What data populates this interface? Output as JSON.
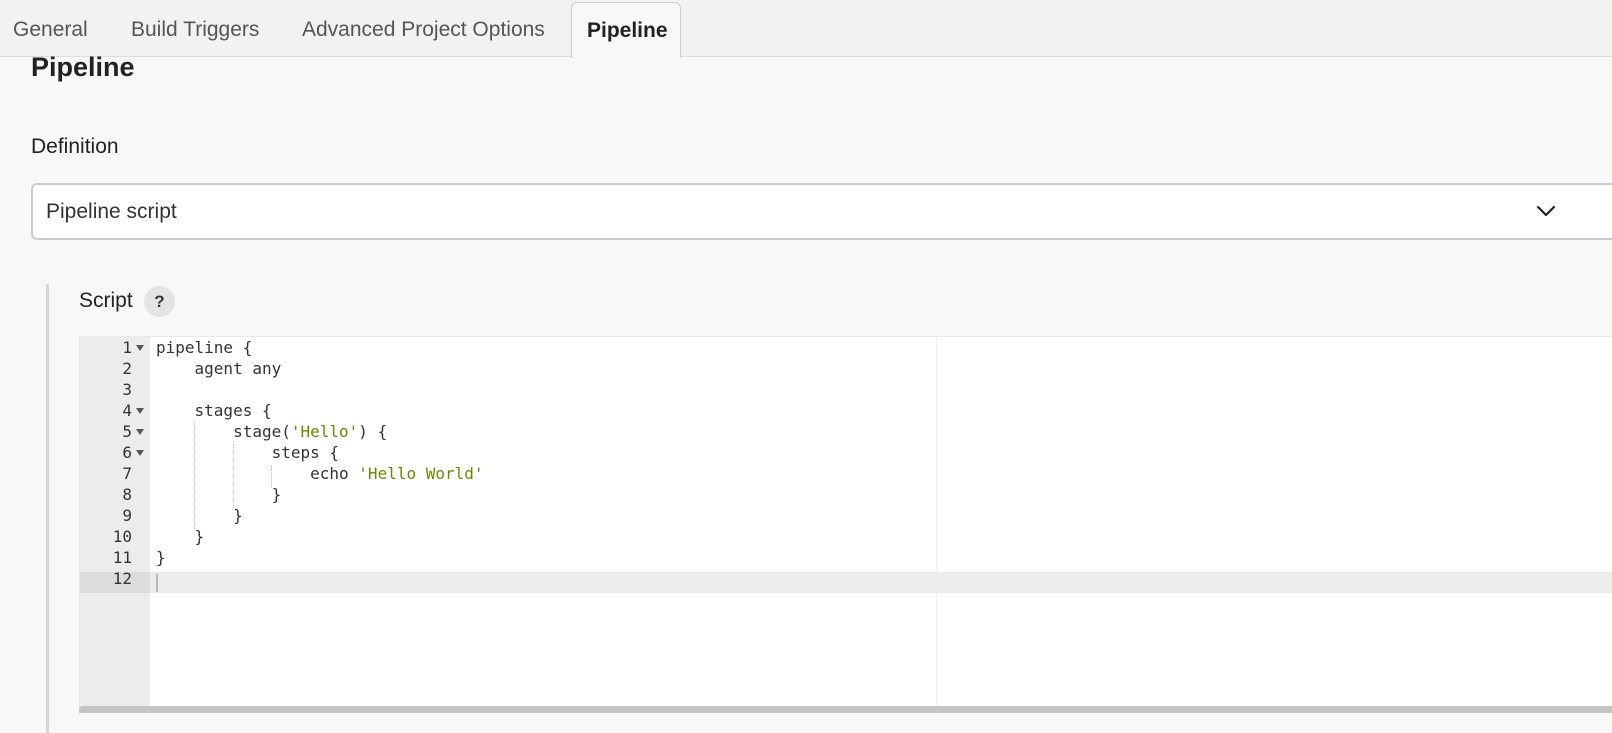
{
  "tabs": [
    {
      "label": "General",
      "active": false
    },
    {
      "label": "Build Triggers",
      "active": false
    },
    {
      "label": "Advanced Project Options",
      "active": false
    },
    {
      "label": "Pipeline",
      "active": true
    }
  ],
  "section": {
    "title": "Pipeline"
  },
  "definition": {
    "label": "Definition",
    "selected": "Pipeline script",
    "chevron_icon": "chevron-down-icon"
  },
  "script": {
    "label": "Script",
    "help": "?",
    "lines": [
      {
        "n": "1",
        "parts": [
          {
            "t": "pipeline {"
          }
        ]
      },
      {
        "n": "2",
        "parts": [
          {
            "t": "    agent any"
          }
        ]
      },
      {
        "n": "3",
        "parts": [
          {
            "t": ""
          }
        ]
      },
      {
        "n": "4",
        "parts": [
          {
            "t": "    stages {"
          }
        ]
      },
      {
        "n": "5",
        "parts": [
          {
            "t": "        stage("
          },
          {
            "t": "'Hello'",
            "s": true
          },
          {
            "t": ") {"
          }
        ]
      },
      {
        "n": "6",
        "parts": [
          {
            "t": "            steps {"
          }
        ]
      },
      {
        "n": "7",
        "parts": [
          {
            "t": "                echo "
          },
          {
            "t": "'Hello World'",
            "s": true
          }
        ]
      },
      {
        "n": "8",
        "parts": [
          {
            "t": "            }"
          }
        ]
      },
      {
        "n": "9",
        "parts": [
          {
            "t": "        }"
          }
        ]
      },
      {
        "n": "10",
        "parts": [
          {
            "t": "    }"
          }
        ]
      },
      {
        "n": "11",
        "parts": [
          {
            "t": "}"
          }
        ]
      },
      {
        "n": "12",
        "parts": [
          {
            "t": ""
          }
        ]
      }
    ]
  },
  "colors": {
    "string": "#6a8a00",
    "gutter": "#ececec",
    "active_line": "#dcdcdc"
  }
}
